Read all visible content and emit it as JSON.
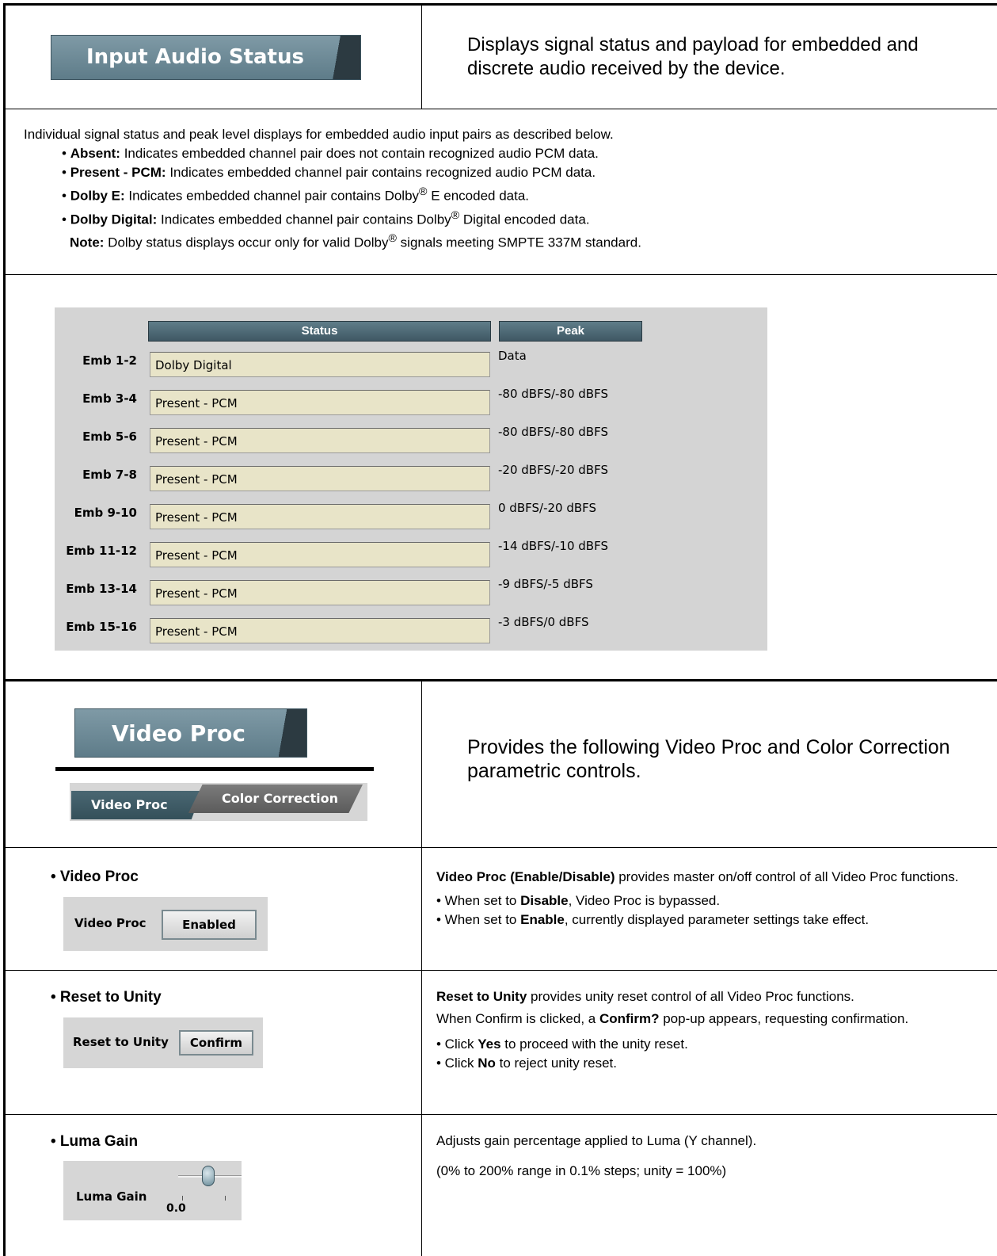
{
  "input_audio": {
    "tab_label": "Input Audio Status",
    "summary": "Displays signal status and payload for embedded and discrete audio received by the device.",
    "intro": "Individual signal status and peak level displays for embedded audio input pairs as described below.",
    "bullets": [
      {
        "term": "Absent:",
        "text": " Indicates embedded channel pair does not contain recognized audio PCM data."
      },
      {
        "term": "Present - PCM:",
        "text": " Indicates embedded channel pair contains recognized audio PCM data."
      },
      {
        "term": "Dolby E:",
        "text_a": " Indicates embedded channel pair contains Dolby",
        "text_b": " E encoded data."
      },
      {
        "term": "Dolby Digital:",
        "text_a": " Indicates embedded channel pair contains Dolby",
        "text_b": " Digital encoded data."
      }
    ],
    "note_term": "Note:",
    "note_a": " Dolby status displays occur only for valid Dolby",
    "note_b": " signals meeting SMPTE 337M standard.",
    "reg_mark": "®",
    "panel": {
      "status_header": "Status",
      "peak_header": "Peak",
      "rows": [
        {
          "label": "Emb 1-2",
          "status": "Dolby Digital",
          "peak": "Data"
        },
        {
          "label": "Emb 3-4",
          "status": "Present - PCM",
          "peak": "-80 dBFS/-80 dBFS"
        },
        {
          "label": "Emb 5-6",
          "status": "Present - PCM",
          "peak": "-80 dBFS/-80 dBFS"
        },
        {
          "label": "Emb 7-8",
          "status": "Present - PCM",
          "peak": "-20 dBFS/-20 dBFS"
        },
        {
          "label": "Emb 9-10",
          "status": "Present - PCM",
          "peak": "0 dBFS/-20 dBFS"
        },
        {
          "label": "Emb 11-12",
          "status": "Present - PCM",
          "peak": "-14 dBFS/-10 dBFS"
        },
        {
          "label": "Emb 13-14",
          "status": "Present - PCM",
          "peak": "-9 dBFS/-5 dBFS"
        },
        {
          "label": "Emb 15-16",
          "status": "Present - PCM",
          "peak": "-3 dBFS/0 dBFS"
        }
      ]
    }
  },
  "video_proc": {
    "tab_label": "Video Proc",
    "subtab_1": "Video Proc",
    "subtab_2": "Color Correction",
    "summary": "Provides the following Video Proc and Color Correction parametric controls.",
    "controls": {
      "enable": {
        "title": "• Video Proc",
        "label": "Video Proc",
        "button": "Enabled",
        "desc_term": "Video Proc (Enable/Disable)",
        "desc_rest": " provides master on/off control of all Video Proc functions.",
        "b1_a": "• When set to ",
        "b1_term": "Disable",
        "b1_b": ", Video Proc is bypassed.",
        "b2_a": "• When set to ",
        "b2_term": "Enable",
        "b2_b": ", currently displayed parameter settings take effect."
      },
      "reset": {
        "title": "• Reset to Unity",
        "label": "Reset to Unity",
        "button": "Confirm",
        "desc_term": "Reset to Unity",
        "desc_rest": " provides unity reset control of all Video Proc functions.",
        "p2_a": "When Confirm is clicked, a ",
        "p2_term": "Confirm?",
        "p2_b": " pop-up appears, requesting confirmation.",
        "b1_a": "• Click ",
        "b1_term": "Yes",
        "b1_b": " to proceed with the unity reset.",
        "b2_a": "• Click ",
        "b2_term": "No",
        "b2_b": " to reject unity reset."
      },
      "luma": {
        "title": "• Luma Gain",
        "label": "Luma Gain",
        "value": "0.0",
        "desc1": "Adjusts gain percentage applied to Luma (Y channel).",
        "desc2": "(0% to 200% range in 0.1% steps; unity = 100%)"
      }
    }
  }
}
